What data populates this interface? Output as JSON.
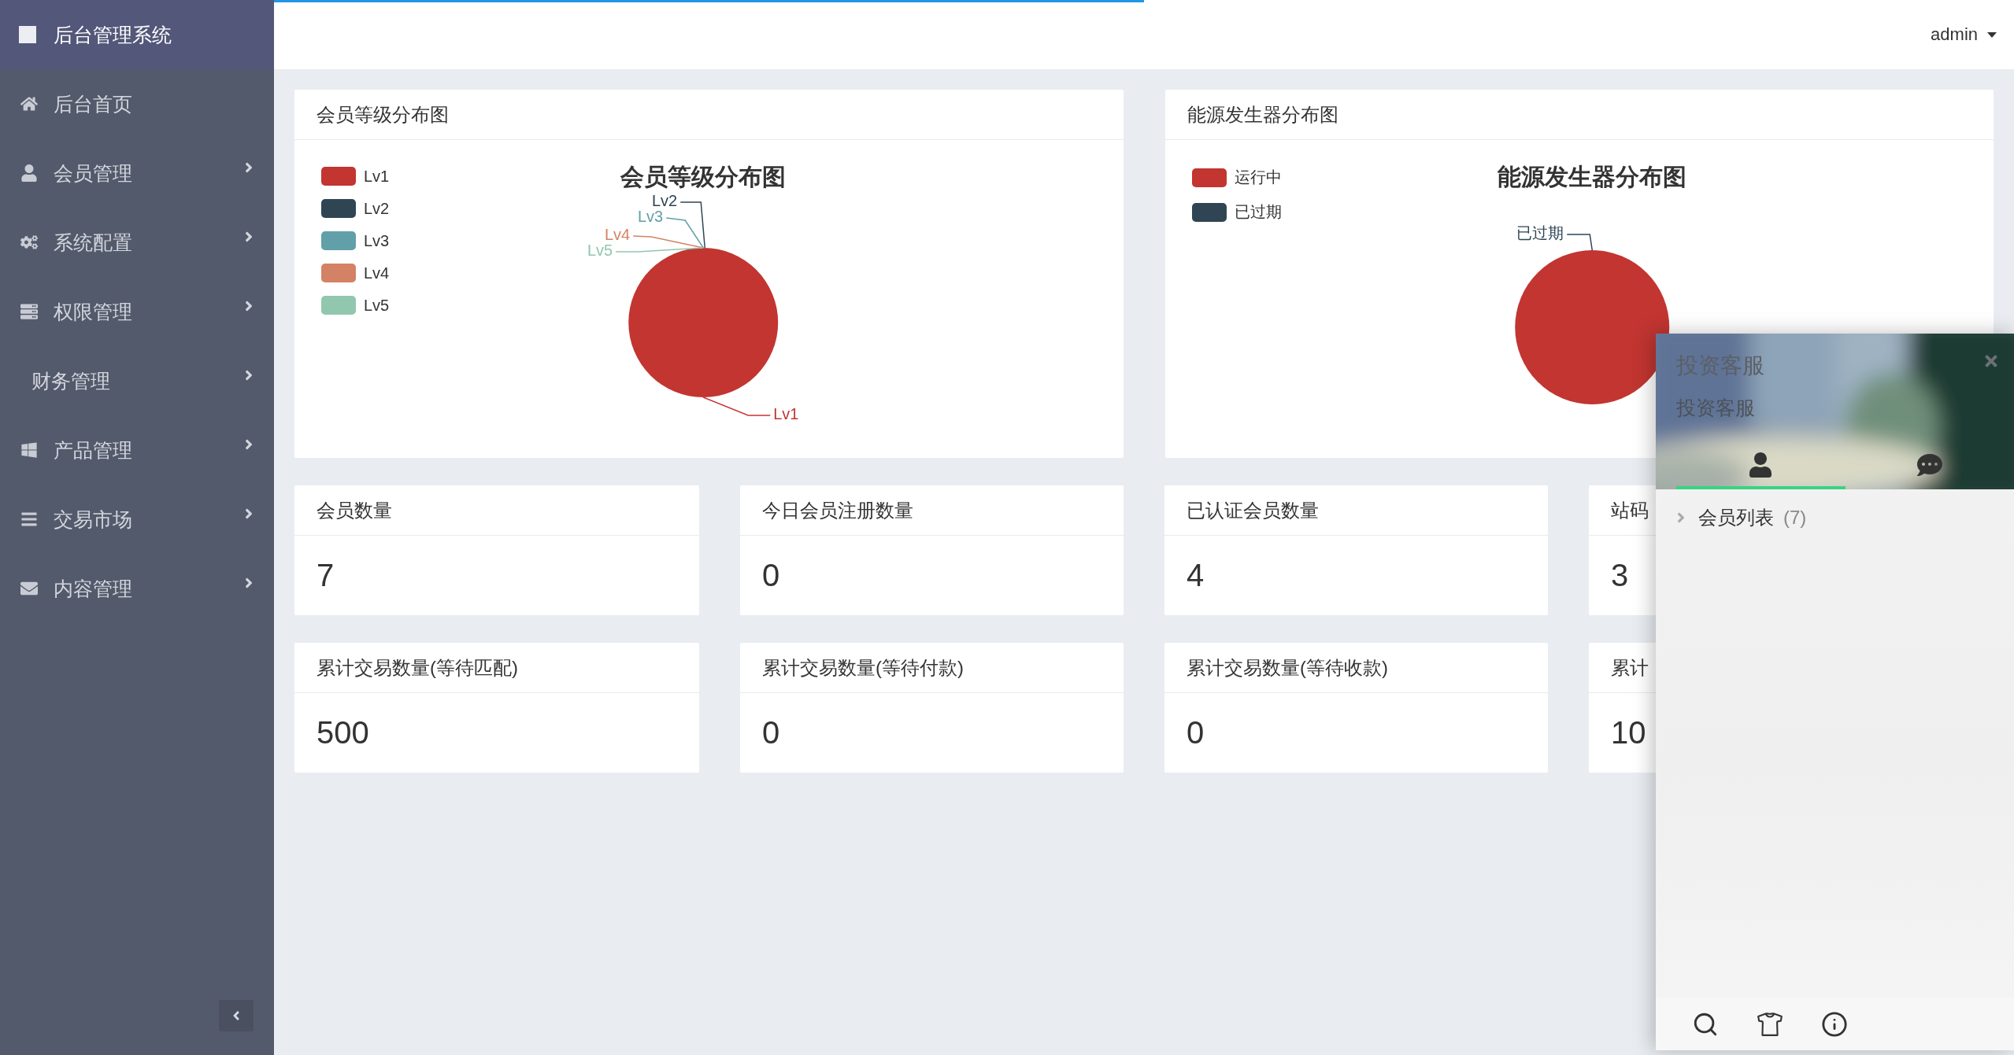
{
  "sidebar": {
    "title": "后台管理系统",
    "items": [
      {
        "label": "后台首页",
        "has_submenu": false
      },
      {
        "label": "会员管理",
        "has_submenu": true
      },
      {
        "label": "系统配置",
        "has_submenu": true
      },
      {
        "label": "权限管理",
        "has_submenu": true
      },
      {
        "label": "财务管理",
        "has_submenu": true
      },
      {
        "label": "产品管理",
        "has_submenu": true
      },
      {
        "label": "交易市场",
        "has_submenu": true
      },
      {
        "label": "内容管理",
        "has_submenu": true
      }
    ]
  },
  "topbar": {
    "user": "admin",
    "loading": {
      "level": 0.5
    }
  },
  "charts": [
    {
      "title": "会员等级分布图",
      "legend_colors": [
        {
          "color": "#c23531"
        },
        {
          "color": "#2f4554"
        },
        {
          "color": "#61a0a8"
        },
        {
          "color": "#d48265"
        },
        {
          "color": "#91c7ae"
        }
      ],
      "slice_labels": [
        {
          "label": "Lv1",
          "kind": "bottom",
          "color": "#c23531"
        },
        {
          "label": "Lv2",
          "kind": "top",
          "color": "#2f4554"
        },
        {
          "label": "Lv3",
          "kind": "top",
          "color": "#61a0a8"
        },
        {
          "label": "Lv4",
          "kind": "top",
          "color": "#d48265"
        },
        {
          "label": "Lv5",
          "kind": "top",
          "color": "#91c7ae"
        }
      ],
      "chart_data": {
        "type": "pie",
        "title": "会员等级分布图",
        "categories": [
          "Lv1",
          "Lv2",
          "Lv3",
          "Lv4",
          "Lv5"
        ],
        "values": [
          100,
          0,
          0,
          0,
          0
        ]
      }
    },
    {
      "title": "能源发生器分布图",
      "legend_colors": [
        {
          "color": "#c23531"
        },
        {
          "color": "#2f4554"
        }
      ],
      "slice_labels": [
        {
          "label": "已过期",
          "kind": "top",
          "color": "#2f4554"
        }
      ],
      "chart_data": {
        "type": "pie",
        "title": "能源发生器分布图",
        "categories": [
          "运行中",
          "已过期"
        ],
        "values": [
          100,
          0
        ]
      }
    }
  ],
  "stats": [
    {
      "label": "会员数量",
      "value": "7"
    },
    {
      "label": "今日会员注册数量",
      "value": "0"
    },
    {
      "label": "已认证会员数量",
      "value": "4"
    },
    {
      "label": "站码",
      "value": "3"
    },
    {
      "label": "累计交易数量(等待匹配)",
      "value": "500"
    },
    {
      "label": "累计交易数量(等待付款)",
      "value": "0"
    },
    {
      "label": "累计交易数量(等待收款)",
      "value": "0"
    },
    {
      "label": "累计",
      "value": "10"
    }
  ],
  "chat_panel": {
    "title": "投资客服",
    "subtitle": "投资客服",
    "tabs": [
      {
        "selected": true
      },
      {
        "selected": false
      }
    ],
    "groups": [
      {
        "label": "会员列表",
        "count": "(7)"
      }
    ]
  }
}
